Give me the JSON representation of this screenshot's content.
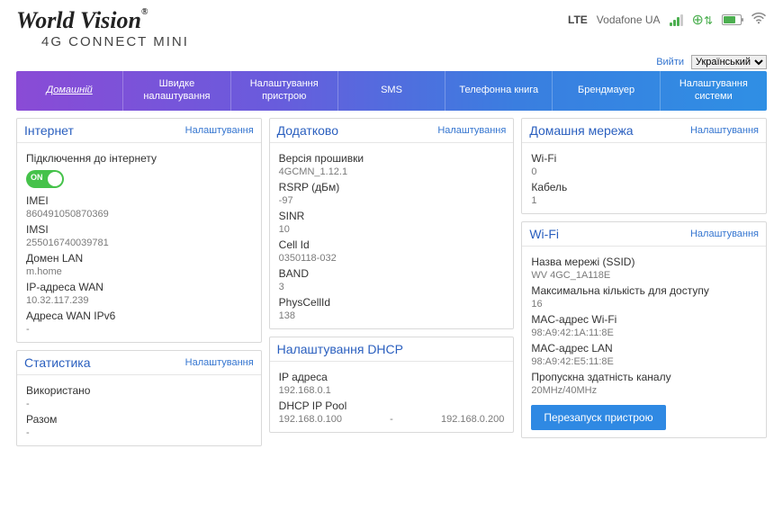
{
  "brand": {
    "name": "World Vision",
    "sub": "4G CONNECT MINI",
    "reg": "®"
  },
  "status": {
    "netType": "LTE",
    "operator": "Vodafone UA"
  },
  "tools": {
    "logout": "Вийти",
    "langs": [
      "Український"
    ]
  },
  "nav": {
    "items": [
      "Домашній",
      "Швидке налаштування",
      "Налаштування пристрою",
      "SMS",
      "Телефонна книга",
      "Брендмауер",
      "Налаштування системи"
    ]
  },
  "cards": {
    "internet": {
      "title": "Інтернет",
      "link": "Налаштування",
      "connLabel": "Підключення до інтернету",
      "toggleText": "ON",
      "rows": [
        {
          "k": "IMEI",
          "v": "860491050870369"
        },
        {
          "k": "IMSI",
          "v": "255016740039781"
        },
        {
          "k": "Домен LAN",
          "v": "m.home"
        },
        {
          "k": "IP-адреса WAN",
          "v": "10.32.117.239"
        },
        {
          "k": "Адреса WAN IPv6",
          "v": "-"
        }
      ]
    },
    "stats": {
      "title": "Статистика",
      "link": "Налаштування",
      "rows": [
        {
          "k": "Використано",
          "v": "-"
        },
        {
          "k": "Разом",
          "v": "-"
        }
      ]
    },
    "extra": {
      "title": "Додатково",
      "link": "Налаштування",
      "rows": [
        {
          "k": "Версія прошивки",
          "v": "4GCMN_1.12.1"
        },
        {
          "k": "RSRP (дБм)",
          "v": "-97"
        },
        {
          "k": "SINR",
          "v": "10"
        },
        {
          "k": "Cell Id",
          "v": "0350118-032"
        },
        {
          "k": "BAND",
          "v": "3"
        },
        {
          "k": "PhysCellId",
          "v": "138"
        }
      ]
    },
    "dhcp": {
      "title": "Налаштування DHCP",
      "ipLabel": "IP адреса",
      "ip": "192.168.0.1",
      "poolLabel": "DHCP IP Pool",
      "poolStart": "192.168.0.100",
      "poolSep": "-",
      "poolEnd": "192.168.0.200"
    },
    "home": {
      "title": "Домашня мережа",
      "link": "Налаштування",
      "rows": [
        {
          "k": "Wi-Fi",
          "v": "0"
        },
        {
          "k": "Кабель",
          "v": "1"
        }
      ]
    },
    "wifi": {
      "title": "Wi-Fi",
      "link": "Налаштування",
      "rows": [
        {
          "k": "Назва мережі (SSID)",
          "v": "WV 4GC_1A118E"
        },
        {
          "k": "Максимальна кількість для доступу",
          "v": "16"
        },
        {
          "k": "MAC-адрес Wi-Fi",
          "v": "98:A9:42:1A:11:8E"
        },
        {
          "k": "MAC-адрес LAN",
          "v": "98:A9:42:E5:11:8E"
        },
        {
          "k": "Пропускна здатність каналу",
          "v": "20MHz/40MHz"
        }
      ],
      "restart": "Перезапуск пристрою"
    }
  }
}
